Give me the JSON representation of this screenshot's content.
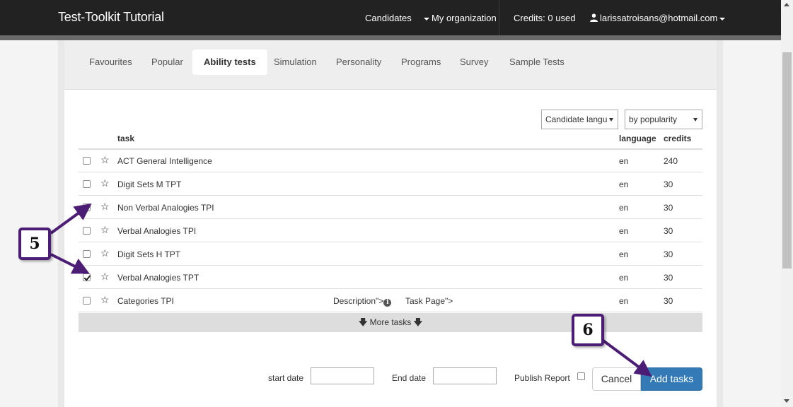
{
  "navbar": {
    "brand": "Test-Toolkit Tutorial",
    "candidates": "Candidates",
    "my_organization": "My organization",
    "credits": "Credits: 0 used",
    "user_email": "larissatroisans@hotmail.com"
  },
  "tabs": [
    {
      "label": "Favourites",
      "active": false
    },
    {
      "label": "Popular",
      "active": false
    },
    {
      "label": "Ability tests",
      "active": true
    },
    {
      "label": "Simulation",
      "active": false
    },
    {
      "label": "Personality",
      "active": false
    },
    {
      "label": "Programs",
      "active": false
    },
    {
      "label": "Survey",
      "active": false
    },
    {
      "label": "Sample Tests",
      "active": false
    }
  ],
  "filters": {
    "language_select": "Candidate langu",
    "sort_select": "by popularity"
  },
  "table": {
    "headers": {
      "task": "task",
      "language": "language",
      "credits": "credits"
    },
    "rows": [
      {
        "name": "ACT General Intelligence",
        "language": "en",
        "credits": "240",
        "checked": false
      },
      {
        "name": "Digit Sets M TPT",
        "language": "en",
        "credits": "30",
        "checked": false
      },
      {
        "name": "Non Verbal Analogies TPI",
        "language": "en",
        "credits": "30",
        "checked": true
      },
      {
        "name": "Verbal Analogies TPI",
        "language": "en",
        "credits": "30",
        "checked": false
      },
      {
        "name": "Digit Sets H TPT",
        "language": "en",
        "credits": "30",
        "checked": false
      },
      {
        "name": "Verbal Analogies TPT",
        "language": "en",
        "credits": "30",
        "checked": true
      },
      {
        "name": "Categories TPI",
        "language": "en",
        "credits": "30",
        "checked": false,
        "description": "Description\">",
        "task_page": "Task Page\">"
      }
    ],
    "more_tasks": "More tasks"
  },
  "form": {
    "start_date_label": "start date",
    "end_date_label": "End date",
    "publish_report_label": "Publish Report",
    "cancel_label": "Cancel",
    "add_tasks_label": "Add tasks",
    "start_date_value": "",
    "end_date_value": ""
  },
  "annotations": {
    "step_5": "5",
    "step_6": "6"
  },
  "colors": {
    "navbar_bg": "#222222",
    "primary_button": "#337ab7",
    "callout_border": "#4b1d75"
  }
}
